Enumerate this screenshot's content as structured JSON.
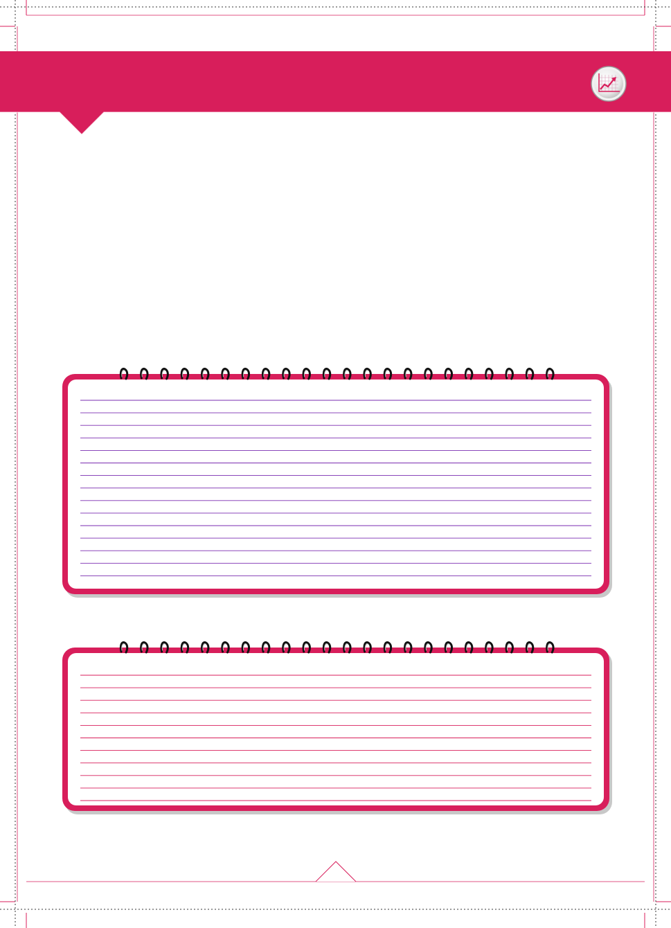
{
  "page": {
    "background": "#ffffff",
    "accent_color": "#d81e5b",
    "guide_color": "#a0144a"
  },
  "header": {
    "icon": "chart-growth-icon"
  },
  "notebooks": [
    {
      "name": "notebook-upper",
      "ring_count": 22,
      "line_count": 15,
      "line_color": "#7a2bb0"
    },
    {
      "name": "notebook-lower",
      "ring_count": 22,
      "line_count": 11,
      "line_color": "#d81e5b"
    }
  ]
}
